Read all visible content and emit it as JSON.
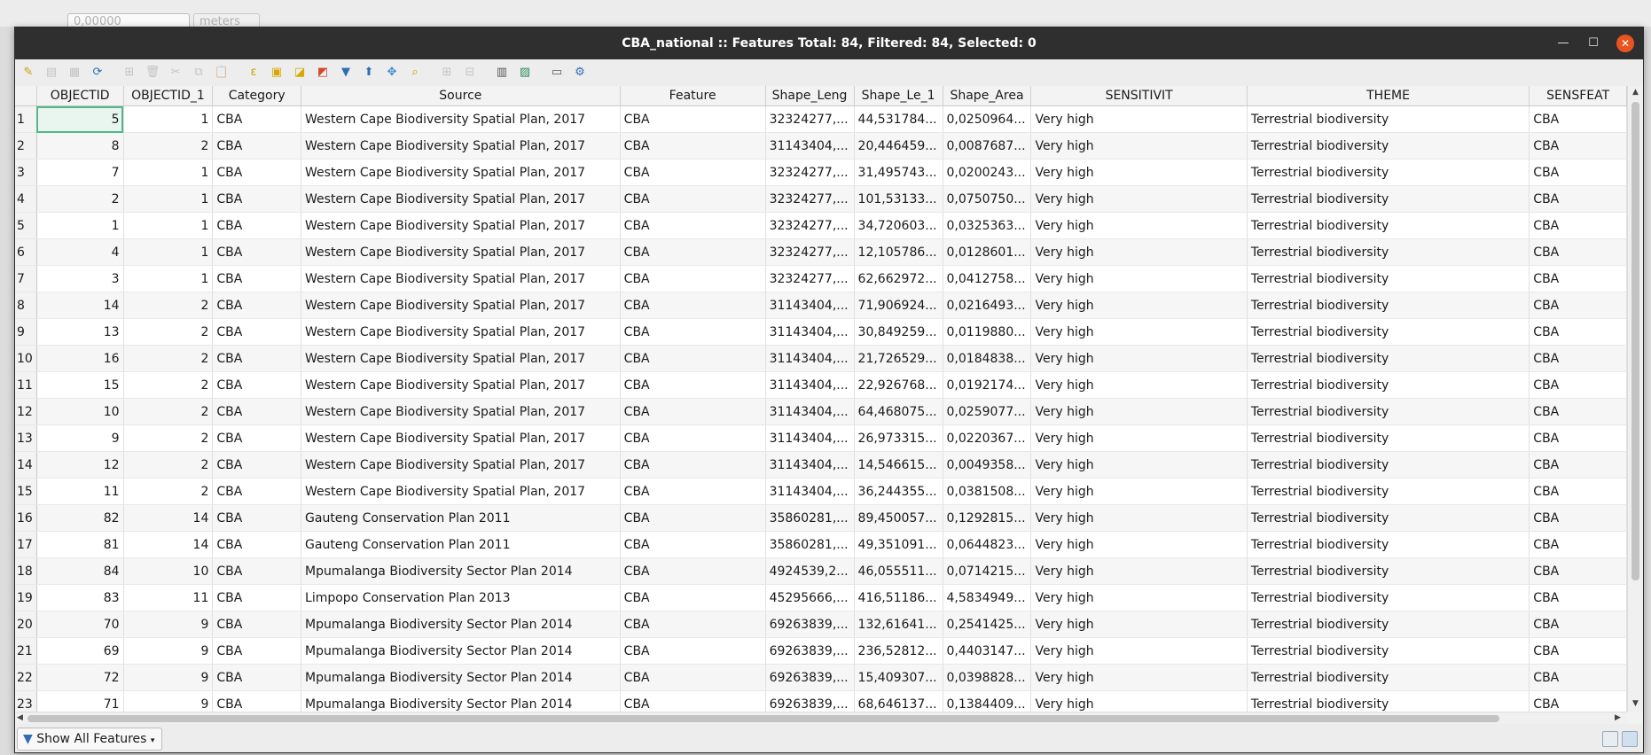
{
  "background": {
    "tolerance_value": "0,00000",
    "unit": "meters"
  },
  "window": {
    "title": "CBA_national :: Features Total: 84, Filtered: 84, Selected: 0",
    "minimize": "—",
    "maximize": "☐",
    "close": "✕"
  },
  "toolbar": {
    "icons": [
      {
        "name": "toggle-editing-icon",
        "glyph": "✎",
        "color": "#c9a100",
        "enabled": true
      },
      {
        "name": "toggle-multi-edit-icon",
        "glyph": "▤",
        "color": "#777777",
        "enabled": false
      },
      {
        "name": "save-edits-icon",
        "glyph": "▦",
        "color": "#777777",
        "enabled": false
      },
      {
        "name": "reload-table-icon",
        "glyph": "⟳",
        "color": "#2f6db5",
        "enabled": true
      },
      {
        "name": "add-feature-icon",
        "glyph": "⊞",
        "color": "#777777",
        "enabled": false
      },
      {
        "name": "delete-selected-icon",
        "glyph": "🗑",
        "color": "#777777",
        "enabled": false
      },
      {
        "name": "cut-icon",
        "glyph": "✂",
        "color": "#777777",
        "enabled": false
      },
      {
        "name": "copy-icon",
        "glyph": "⧉",
        "color": "#777777",
        "enabled": false
      },
      {
        "name": "paste-icon",
        "glyph": "📋",
        "color": "#777777",
        "enabled": false
      },
      {
        "name": "select-by-expression-icon",
        "glyph": "ε",
        "color": "#c9a100",
        "enabled": true
      },
      {
        "name": "select-all-icon",
        "glyph": "▣",
        "color": "#d6a800",
        "enabled": true
      },
      {
        "name": "invert-selection-icon",
        "glyph": "◪",
        "color": "#d6a800",
        "enabled": true
      },
      {
        "name": "deselect-all-icon",
        "glyph": "◩",
        "color": "#d04a2a",
        "enabled": true
      },
      {
        "name": "filter-select-icon",
        "glyph": "▼",
        "color": "#2f6db5",
        "enabled": true
      },
      {
        "name": "move-selection-top-icon",
        "glyph": "⬆",
        "color": "#2f6db5",
        "enabled": true
      },
      {
        "name": "pan-to-selected-icon",
        "glyph": "✥",
        "color": "#3d8ad4",
        "enabled": true
      },
      {
        "name": "zoom-to-selected-icon",
        "glyph": "⌕",
        "color": "#c9a100",
        "enabled": true
      },
      {
        "name": "new-field-icon",
        "glyph": "⊞",
        "color": "#777777",
        "enabled": false
      },
      {
        "name": "delete-field-icon",
        "glyph": "⊟",
        "color": "#777777",
        "enabled": false
      },
      {
        "name": "field-calculator-icon",
        "glyph": "▥",
        "color": "#555555",
        "enabled": true
      },
      {
        "name": "conditional-formatting-icon",
        "glyph": "▨",
        "color": "#2f8a5a",
        "enabled": true
      },
      {
        "name": "dock-table-icon",
        "glyph": "▭",
        "color": "#555555",
        "enabled": true
      },
      {
        "name": "actions-icon",
        "glyph": "⚙",
        "color": "#2f6db5",
        "enabled": true
      }
    ]
  },
  "table": {
    "columns": [
      "OBJECTID",
      "OBJECTID_1",
      "Category",
      "Source",
      "Feature",
      "Shape_Leng",
      "Shape_Le_1",
      "Shape_Area",
      "SENSITIVIT",
      "THEME",
      "SENSFEAT"
    ],
    "rows": [
      [
        "1",
        "5",
        "1",
        "CBA",
        "Western Cape Biodiversity Spatial Plan, 2017",
        "CBA",
        "32324277,...",
        "44,531784...",
        "0,0250964...",
        "Very high",
        "Terrestrial biodiversity",
        "CBA"
      ],
      [
        "2",
        "8",
        "2",
        "CBA",
        "Western Cape Biodiversity Spatial Plan, 2017",
        "CBA",
        "31143404,...",
        "20,446459...",
        "0,0087687...",
        "Very high",
        "Terrestrial biodiversity",
        "CBA"
      ],
      [
        "3",
        "7",
        "1",
        "CBA",
        "Western Cape Biodiversity Spatial Plan, 2017",
        "CBA",
        "32324277,...",
        "31,495743...",
        "0,0200243...",
        "Very high",
        "Terrestrial biodiversity",
        "CBA"
      ],
      [
        "4",
        "2",
        "1",
        "CBA",
        "Western Cape Biodiversity Spatial Plan, 2017",
        "CBA",
        "32324277,...",
        "101,53133...",
        "0,0750750...",
        "Very high",
        "Terrestrial biodiversity",
        "CBA"
      ],
      [
        "5",
        "1",
        "1",
        "CBA",
        "Western Cape Biodiversity Spatial Plan, 2017",
        "CBA",
        "32324277,...",
        "34,720603...",
        "0,0325363...",
        "Very high",
        "Terrestrial biodiversity",
        "CBA"
      ],
      [
        "6",
        "4",
        "1",
        "CBA",
        "Western Cape Biodiversity Spatial Plan, 2017",
        "CBA",
        "32324277,...",
        "12,105786...",
        "0,0128601...",
        "Very high",
        "Terrestrial biodiversity",
        "CBA"
      ],
      [
        "7",
        "3",
        "1",
        "CBA",
        "Western Cape Biodiversity Spatial Plan, 2017",
        "CBA",
        "32324277,...",
        "62,662972...",
        "0,0412758...",
        "Very high",
        "Terrestrial biodiversity",
        "CBA"
      ],
      [
        "8",
        "14",
        "2",
        "CBA",
        "Western Cape Biodiversity Spatial Plan, 2017",
        "CBA",
        "31143404,...",
        "71,906924...",
        "0,0216493...",
        "Very high",
        "Terrestrial biodiversity",
        "CBA"
      ],
      [
        "9",
        "13",
        "2",
        "CBA",
        "Western Cape Biodiversity Spatial Plan, 2017",
        "CBA",
        "31143404,...",
        "30,849259...",
        "0,0119880...",
        "Very high",
        "Terrestrial biodiversity",
        "CBA"
      ],
      [
        "10",
        "16",
        "2",
        "CBA",
        "Western Cape Biodiversity Spatial Plan, 2017",
        "CBA",
        "31143404,...",
        "21,726529...",
        "0,0184838...",
        "Very high",
        "Terrestrial biodiversity",
        "CBA"
      ],
      [
        "11",
        "15",
        "2",
        "CBA",
        "Western Cape Biodiversity Spatial Plan, 2017",
        "CBA",
        "31143404,...",
        "22,926768...",
        "0,0192174...",
        "Very high",
        "Terrestrial biodiversity",
        "CBA"
      ],
      [
        "12",
        "10",
        "2",
        "CBA",
        "Western Cape Biodiversity Spatial Plan, 2017",
        "CBA",
        "31143404,...",
        "64,468075...",
        "0,0259077...",
        "Very high",
        "Terrestrial biodiversity",
        "CBA"
      ],
      [
        "13",
        "9",
        "2",
        "CBA",
        "Western Cape Biodiversity Spatial Plan, 2017",
        "CBA",
        "31143404,...",
        "26,973315...",
        "0,0220367...",
        "Very high",
        "Terrestrial biodiversity",
        "CBA"
      ],
      [
        "14",
        "12",
        "2",
        "CBA",
        "Western Cape Biodiversity Spatial Plan, 2017",
        "CBA",
        "31143404,...",
        "14,546615...",
        "0,0049358...",
        "Very high",
        "Terrestrial biodiversity",
        "CBA"
      ],
      [
        "15",
        "11",
        "2",
        "CBA",
        "Western Cape Biodiversity Spatial Plan, 2017",
        "CBA",
        "31143404,...",
        "36,244355...",
        "0,0381508...",
        "Very high",
        "Terrestrial biodiversity",
        "CBA"
      ],
      [
        "16",
        "82",
        "14",
        "CBA",
        "Gauteng Conservation Plan 2011",
        "CBA",
        "35860281,...",
        "89,450057...",
        "0,1292815...",
        "Very high",
        "Terrestrial biodiversity",
        "CBA"
      ],
      [
        "17",
        "81",
        "14",
        "CBA",
        "Gauteng Conservation Plan 2011",
        "CBA",
        "35860281,...",
        "49,351091...",
        "0,0644823...",
        "Very high",
        "Terrestrial biodiversity",
        "CBA"
      ],
      [
        "18",
        "84",
        "10",
        "CBA",
        "Mpumalanga Biodiversity Sector Plan 2014",
        "CBA",
        "4924539,2...",
        "46,055511...",
        "0,0714215...",
        "Very high",
        "Terrestrial biodiversity",
        "CBA"
      ],
      [
        "19",
        "83",
        "11",
        "CBA",
        "Limpopo Conservation Plan 2013",
        "CBA",
        "45295666,...",
        "416,51186...",
        "4,5834949...",
        "Very high",
        "Terrestrial biodiversity",
        "CBA"
      ],
      [
        "20",
        "70",
        "9",
        "CBA",
        "Mpumalanga Biodiversity Sector Plan 2014",
        "CBA",
        "69263839,...",
        "132,61641...",
        "0,2541425...",
        "Very high",
        "Terrestrial biodiversity",
        "CBA"
      ],
      [
        "21",
        "69",
        "9",
        "CBA",
        "Mpumalanga Biodiversity Sector Plan 2014",
        "CBA",
        "69263839,...",
        "236,52812...",
        "0,4403147...",
        "Very high",
        "Terrestrial biodiversity",
        "CBA"
      ],
      [
        "22",
        "72",
        "9",
        "CBA",
        "Mpumalanga Biodiversity Sector Plan 2014",
        "CBA",
        "69263839,...",
        "15,409307...",
        "0,0398828...",
        "Very high",
        "Terrestrial biodiversity",
        "CBA"
      ],
      [
        "23",
        "71",
        "9",
        "CBA",
        "Mpumalanga Biodiversity Sector Plan 2014",
        "CBA",
        "69263839,...",
        "68,646137...",
        "0,1384409...",
        "Very high",
        "Terrestrial biodiversity",
        "CBA"
      ]
    ]
  },
  "bottom": {
    "filter_button": "Show All Features"
  }
}
